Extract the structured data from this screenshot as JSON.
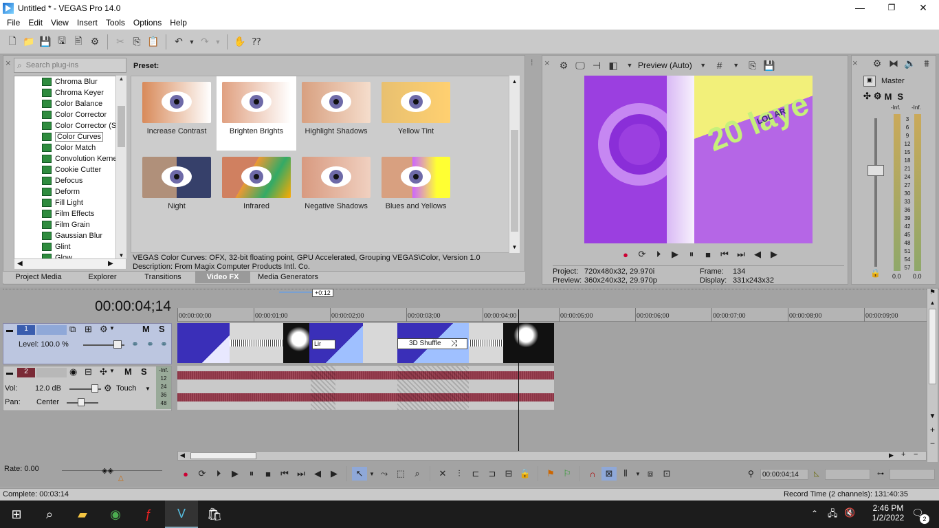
{
  "window": {
    "title": "Untitled * - VEGAS Pro 14.0",
    "minimize": "—",
    "maximize": "❐",
    "close": "✕"
  },
  "menu": [
    "File",
    "Edit",
    "View",
    "Insert",
    "Tools",
    "Options",
    "Help"
  ],
  "fx": {
    "search_placeholder": "Search plug-ins",
    "preset_header": "Preset:",
    "tree_items": [
      "Chroma Blur",
      "Chroma Keyer",
      "Color Balance",
      "Color Corrector",
      "Color Corrector (S",
      "Color Curves",
      "Color Match",
      "Convolution Kerne",
      "Cookie Cutter",
      "Defocus",
      "Deform",
      "Fill Light",
      "Film Effects",
      "Film Grain",
      "Gaussian Blur",
      "Glint",
      "Glow"
    ],
    "selected_item": "Color Curves",
    "presets": [
      "Increase Contrast",
      "Brighten Brights",
      "Highlight Shadows",
      "Yellow Tint",
      "Night",
      "Infrared",
      "Negative Shadows",
      "Blues and Yellows"
    ],
    "selected_preset": "Brighten Brights",
    "info_line1": "VEGAS Color Curves: OFX, 32-bit floating point, GPU Accelerated, Grouping VEGAS\\Color, Version 1.0",
    "info_line2": "Description: From Magix Computer Products Intl. Co.",
    "tabs": [
      "Project Media",
      "Explorer",
      "Transitions",
      "Video FX",
      "Media Generators"
    ],
    "active_tab": "Video FX"
  },
  "preview": {
    "mode": "Preview (Auto)",
    "project_label": "Project:",
    "project_value": "720x480x32, 29.970i",
    "preview_label": "Preview:",
    "preview_value": "360x240x32, 29.970p",
    "frame_label": "Frame:",
    "frame_value": "134",
    "display_label": "Display:",
    "display_value": "331x243x32",
    "overlay_text": "20 laye",
    "overlay_small": "LOL AR"
  },
  "master": {
    "title": "Master",
    "m_label": "M",
    "s_label": "S",
    "inf_left": "-Inf.",
    "inf_right": "-Inf.",
    "scale": [
      "3",
      "6",
      "9",
      "12",
      "15",
      "18",
      "21",
      "24",
      "27",
      "30",
      "33",
      "36",
      "39",
      "42",
      "45",
      "48",
      "51",
      "54",
      "57"
    ],
    "bottom_left": "0.0",
    "bottom_right": "0.0"
  },
  "timeline": {
    "timecode": "00:00:04;14",
    "offset_label": "+0:12",
    "ruler": [
      "00:00:00;00",
      "00:00:01;00",
      "00:00:02;00",
      "00:00:03;00",
      "00:00:04;00",
      "00:00:05;00",
      "00:00:06;00",
      "00:00:07;00",
      "00:00:08;00",
      "00:00:09;00"
    ],
    "track1": {
      "number": "1",
      "level": "Level: 100.0 %",
      "m": "M",
      "s": "S"
    },
    "track2": {
      "number": "2",
      "vol_label": "Vol:",
      "vol_value": "12.0 dB",
      "touch": "Touch",
      "pan_label": "Pan:",
      "pan_value": "Center",
      "m": "M",
      "s": "S",
      "meter": [
        "-Inf.",
        "12",
        "24",
        "36",
        "48"
      ]
    },
    "transition_label": "3D Shuffle",
    "linear_label": "Lir",
    "rate": "Rate: 0.00",
    "cursor_time": "00:00:04;14"
  },
  "status": {
    "complete": "Complete: 00:03:14",
    "record_time": "Record Time (2 channels): 131:40:35"
  },
  "taskbar": {
    "time": "2:46 PM",
    "date": "1/2/2022",
    "notifications": "2"
  },
  "colors": {
    "accent": "#1b6fd1",
    "selected_track": "#bcc6e0",
    "waveform": "#8c3546",
    "preview_purple": "#b566e6",
    "preview_yellow": "#f2f07a"
  }
}
